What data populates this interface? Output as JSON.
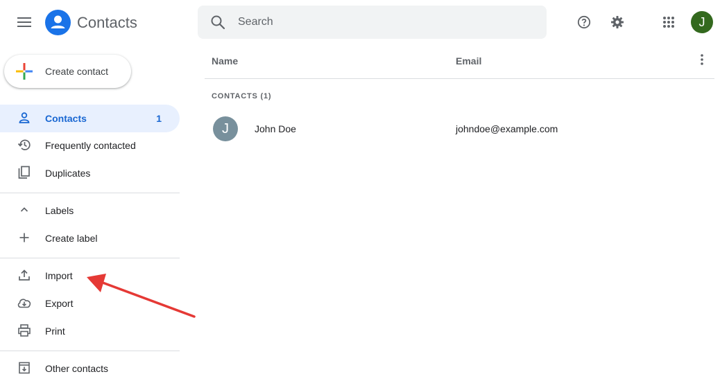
{
  "header": {
    "app_title": "Contacts",
    "search_placeholder": "Search",
    "account_initial": "J",
    "account_color": "#33691e",
    "icons": [
      "menu-icon",
      "contacts-logo-icon",
      "search-icon",
      "help-icon",
      "settings-icon",
      "apps-icon"
    ]
  },
  "sidebar": {
    "create_label": "Create contact",
    "items": [
      {
        "label": "Contacts",
        "count": "1",
        "icon": "person-icon",
        "active": true
      },
      {
        "label": "Frequently contacted",
        "icon": "history-icon"
      },
      {
        "label": "Duplicates",
        "icon": "duplicates-icon"
      },
      {
        "label": "Labels",
        "icon": "chevron-up-icon"
      },
      {
        "label": "Create label",
        "icon": "plus-icon"
      },
      {
        "label": "Import",
        "icon": "upload-icon"
      },
      {
        "label": "Export",
        "icon": "cloud-download-icon"
      },
      {
        "label": "Print",
        "icon": "print-icon"
      },
      {
        "label": "Other contacts",
        "icon": "archive-icon"
      }
    ]
  },
  "main": {
    "columns": [
      "Name",
      "Email"
    ],
    "section_title": "CONTACTS (1)",
    "contacts": [
      {
        "initial": "J",
        "name": "John Doe",
        "email": "johndoe@example.com"
      }
    ]
  },
  "colors": {
    "accent": "#1a73e8",
    "active_bg": "#e8f0fe",
    "annotation_arrow": "#e53935"
  }
}
